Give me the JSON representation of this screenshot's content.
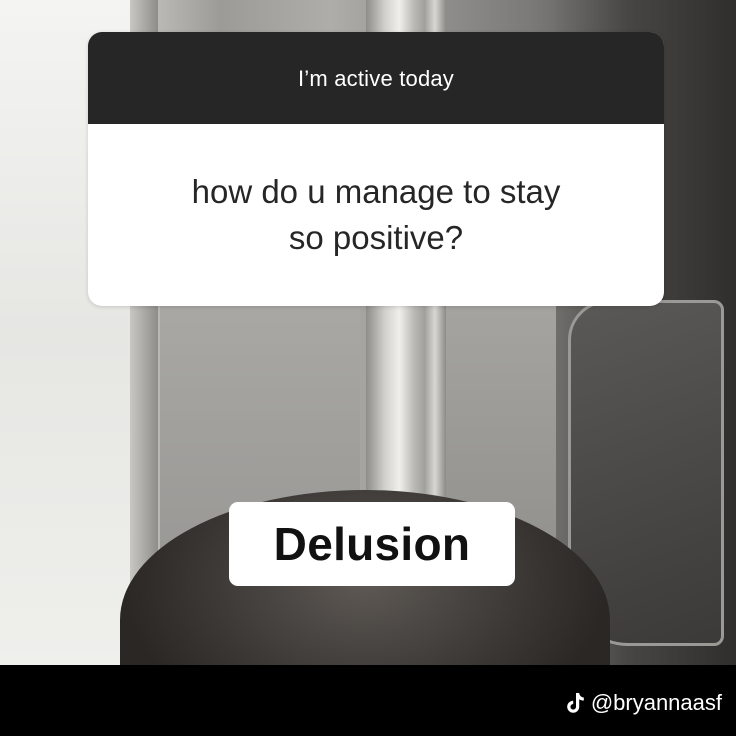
{
  "question": {
    "header": "I’m active today",
    "lines": [
      "how do u manage to stay",
      "so positive?"
    ]
  },
  "answer": "Delusion",
  "watermark": {
    "handle": "@bryannaasf",
    "icon": "tiktok-icon"
  },
  "colors": {
    "header_bg": "#262626",
    "card_bg": "#ffffff",
    "bottom_bar": "#000000"
  }
}
